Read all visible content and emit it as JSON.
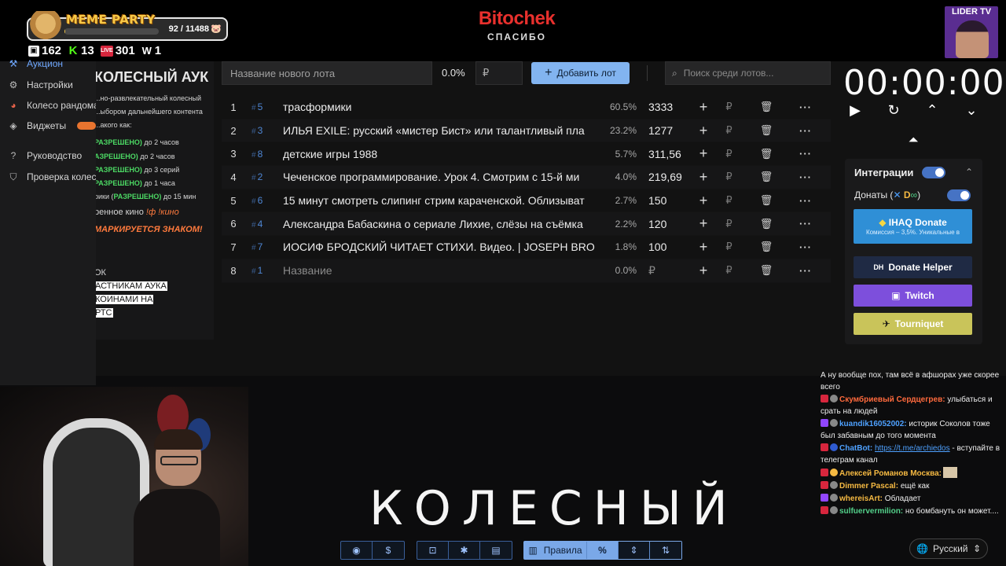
{
  "overlay": {
    "meme_party": {
      "title": "MEME PARTY",
      "count": "92 / 11488",
      "progress": 0.008
    },
    "stats": [
      {
        "icon": "twitch-icon",
        "value": "162"
      },
      {
        "icon": "kick-icon",
        "value": "13"
      },
      {
        "icon": "live-icon",
        "value": "301"
      },
      {
        "icon": "w-icon",
        "value": "1"
      }
    ],
    "brand": {
      "name": "Bitochek",
      "subtitle": "СПАСИБО"
    },
    "lider_tv": "LIDER TV"
  },
  "sidebar": {
    "items": [
      {
        "label": "Аукцион",
        "icon": "gavel-icon",
        "active": true
      },
      {
        "label": "Настройки",
        "icon": "gear-icon"
      },
      {
        "label": "Колесо рандома",
        "icon": "wheel-icon"
      },
      {
        "label": "Виджеты",
        "icon": "layers-icon"
      },
      {
        "label": "Руководство",
        "icon": "help-icon"
      },
      {
        "label": "Проверка колеса",
        "icon": "shield-check-icon"
      }
    ]
  },
  "info": {
    "title": "КОЛЕСНЫЙ АУК",
    "desc1": "...но-развлекательный колесный",
    "desc2": "...ыбором дальнейшего контента",
    "desc3": "...акого как:",
    "rules": [
      {
        "ok": "РАЗРЕШЕНО)",
        "rest": " до 2 часов"
      },
      {
        "ok": "АЗРЕШЕНО)",
        "rest": " до 2 часов"
      },
      {
        "ok": "РАЗРЕШЕНО)",
        "rest": " до 3 серий"
      },
      {
        "ok": "РАЗРЕШЕНО)",
        "rest": " до 1 часа"
      },
      {
        "pre": "рики (",
        "ok": "РАЗРЕШЕНО)",
        "rest": " до 15 мин"
      }
    ],
    "kino_pre": "ренное кино ",
    "kino_cmd": "!ф !кино",
    "warning": "МАРКИРУЕТСЯ ЗНАКОМ!",
    "ok_line": "ОК",
    "hl1": "АСТНИКАМ АУКА",
    "hl2": "КОИНАМИ НА",
    "hl3": "РТС"
  },
  "toolbar": {
    "lot_placeholder": "Название нового лота",
    "percent": "0.0%",
    "amount_placeholder": "₽",
    "add_label": "Добавить лот",
    "search_placeholder": "Поиск среди лотов..."
  },
  "lots": [
    {
      "n": "1",
      "id": "5",
      "name": "трасформики",
      "pct": "60.5%",
      "amount": "3333"
    },
    {
      "n": "2",
      "id": "3",
      "name": "ИЛЬЯ EXILE: русский «мистер Бист» или талантливый пла",
      "pct": "23.2%",
      "amount": "1277"
    },
    {
      "n": "3",
      "id": "8",
      "name": "детские игры 1988",
      "pct": "5.7%",
      "amount": "311,56"
    },
    {
      "n": "4",
      "id": "2",
      "name": "Чеченское программирование. Урок 4. Смотрим с 15-й ми",
      "pct": "4.0%",
      "amount": "219,69"
    },
    {
      "n": "5",
      "id": "6",
      "name": "15 минут смотреть слипинг стрим караченской. Облизыват",
      "pct": "2.7%",
      "amount": "150"
    },
    {
      "n": "6",
      "id": "4",
      "name": "Александра Бабаскина о сериале Лихие, слёзы на съёмка",
      "pct": "2.2%",
      "amount": "120"
    },
    {
      "n": "7",
      "id": "7",
      "name": "ИОСИФ БРОДСКИЙ ЧИТАЕТ СТИХИ. Видео. | JOSEPH BRO",
      "pct": "1.8%",
      "amount": "100"
    },
    {
      "n": "8",
      "id": "1",
      "name": "Название",
      "pct": "0.0%",
      "amount": "₽",
      "placeholder": true
    }
  ],
  "timer": {
    "value": "00:00:00"
  },
  "integrations": {
    "title": "Интеграции",
    "donates_label": "Донаты (",
    "donates_label_end": ")",
    "ihaq": "IHAQ Donate",
    "ihaq_sub": "Комиссия – 3,5%. Уникальные в",
    "donate_helper": "Donate Helper",
    "twitch": "Twitch",
    "tourniquet": "Tourniquet"
  },
  "chat": [
    {
      "text": "А ну вообще пох, там всё в афшорах уже скорее всего"
    },
    {
      "nick": "Скумбриевый Сердцегрев:",
      "color": "#ff6a3d",
      "text": " улыбаться и срать на людей"
    },
    {
      "nick": "kuandik16052002:",
      "color": "#4ea1ff",
      "text": " историк Соколов тоже был забавным до того момента"
    },
    {
      "nick": "ChatBot:",
      "color": "#4ea1ff",
      "link": "https://t.me/archiedos",
      "text": " - вступайте в телеграм канал"
    },
    {
      "nick": "Алексей Романов Москва:",
      "color": "#f5b942",
      "text": ""
    },
    {
      "nick": "Dimmer Pascal:",
      "color": "#f5b942",
      "text": " ещё как"
    },
    {
      "nick": "whereisArt:",
      "color": "#f5b942",
      "text": " Обладает"
    },
    {
      "nick": "sulfuervermilion:",
      "color": "#53d18a",
      "text": " но бомбануть он может...."
    }
  ],
  "language": "Русский",
  "big_word": "КОЛЕСНЫЙ",
  "bottom_bar": {
    "rules_label": "Правила"
  }
}
